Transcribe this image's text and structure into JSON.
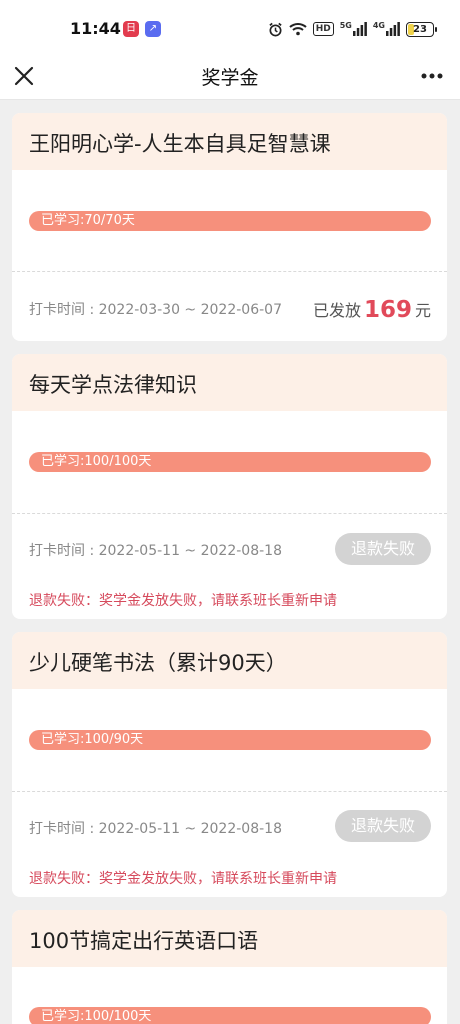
{
  "status_bar": {
    "time": "11:44",
    "app_icon_a": "日",
    "app_icon_b": "↗",
    "network_label": "HD",
    "signal_5g": "5G",
    "signal_4g": "4G",
    "battery": "23"
  },
  "nav": {
    "title": "奖学金",
    "close_icon": "close-icon",
    "more_icon": "more-icon"
  },
  "cards": [
    {
      "title": "王阳明心学-人生本自具足智慧课",
      "progress": "已学习:70/70天",
      "checkin": "打卡时间 : 2022-03-30 ~ 2022-06-07",
      "issued_prefix": "已发放",
      "issued_amount": "169",
      "issued_unit": "元"
    },
    {
      "title": "每天学点法律知识",
      "progress": "已学习:100/100天",
      "checkin": "打卡时间 : 2022-05-11 ~ 2022-08-18",
      "status_button": "退款失败",
      "fail_message": "退款失败：奖学金发放失败，请联系班长重新申请"
    },
    {
      "title": "少儿硬笔书法（累计90天）",
      "progress": "已学习:100/90天",
      "checkin": "打卡时间 : 2022-05-11 ~ 2022-08-18",
      "status_button": "退款失败",
      "fail_message": "退款失败：奖学金发放失败，请联系班长重新申请"
    },
    {
      "title": "100节搞定出行英语口语",
      "progress": "已学习:100/100天"
    }
  ],
  "colors": {
    "card_header_bg": "#fdf0e7",
    "progress_bar": "#f6907c",
    "amount": "#e14a5a",
    "fail_text": "#d64a5c",
    "refund_button": "#d3d3d3"
  }
}
